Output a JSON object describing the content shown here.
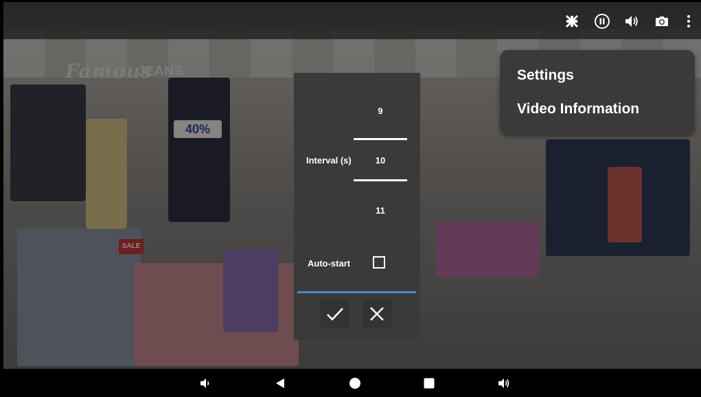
{
  "topbar": {
    "icons": [
      "exit-fullscreen-icon",
      "pause-icon",
      "volume-icon",
      "camera-icon",
      "more-vert-icon"
    ]
  },
  "menu": {
    "items": [
      {
        "label": "Settings"
      },
      {
        "label": "Video Information"
      }
    ]
  },
  "dialog": {
    "interval_label": "Interval (s)",
    "picker": {
      "prev": "9",
      "current": "10",
      "next": "11"
    },
    "autostart_label": "Auto-start",
    "autostart_checked": false
  },
  "scene": {
    "sign_text": "Famous",
    "sign_text2": "JEANS",
    "price_tag": "40%",
    "sale_tag": "SALE"
  },
  "colors": {
    "accent": "#4f86c6",
    "panel": "#3a3a3a"
  },
  "navbar": {
    "icons": [
      "volume-down-icon",
      "back-icon",
      "home-icon",
      "recents-icon",
      "volume-up-icon"
    ]
  }
}
